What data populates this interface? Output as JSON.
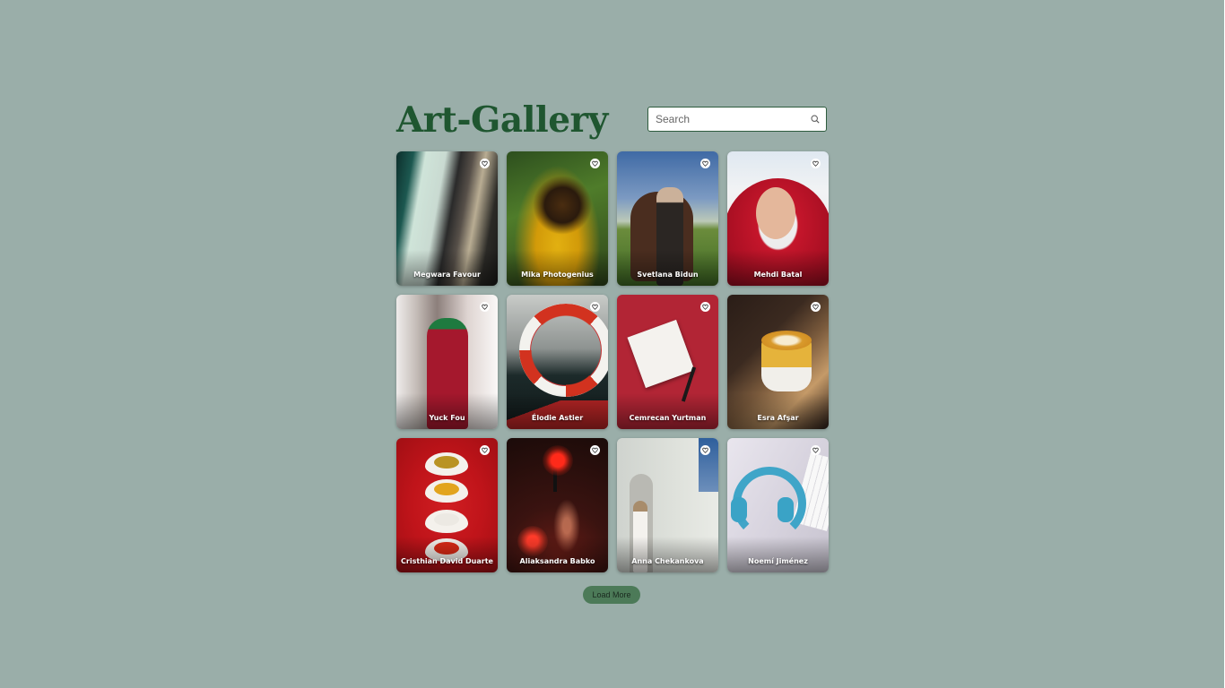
{
  "header": {
    "title": "Art-Gallery"
  },
  "search": {
    "placeholder": "Search",
    "icon": "search-icon"
  },
  "gallery": {
    "items": [
      {
        "author": "Megwara Favour",
        "icon": "like-icon"
      },
      {
        "author": "Mika Photogenius",
        "icon": "like-icon"
      },
      {
        "author": "Svetlana Bidun",
        "icon": "like-icon"
      },
      {
        "author": "Mehdi Batal",
        "icon": "like-icon"
      },
      {
        "author": "Yuck Fou",
        "icon": "like-icon"
      },
      {
        "author": "Élodie Astier",
        "icon": "like-icon"
      },
      {
        "author": "Cemrecan Yurtman",
        "icon": "like-icon"
      },
      {
        "author": "Esra Afşar",
        "icon": "like-icon"
      },
      {
        "author": "Cristhian David Duarte",
        "icon": "like-icon"
      },
      {
        "author": "Aliaksandra Babko",
        "icon": "like-icon"
      },
      {
        "author": "Anna Chekankova",
        "icon": "like-icon"
      },
      {
        "author": "Noemí Jiménez",
        "icon": "like-icon"
      }
    ]
  },
  "load_more": {
    "label": "Load More"
  },
  "colors": {
    "background": "#9aaea9",
    "title": "#1f5630",
    "button": "#4c7a58"
  }
}
